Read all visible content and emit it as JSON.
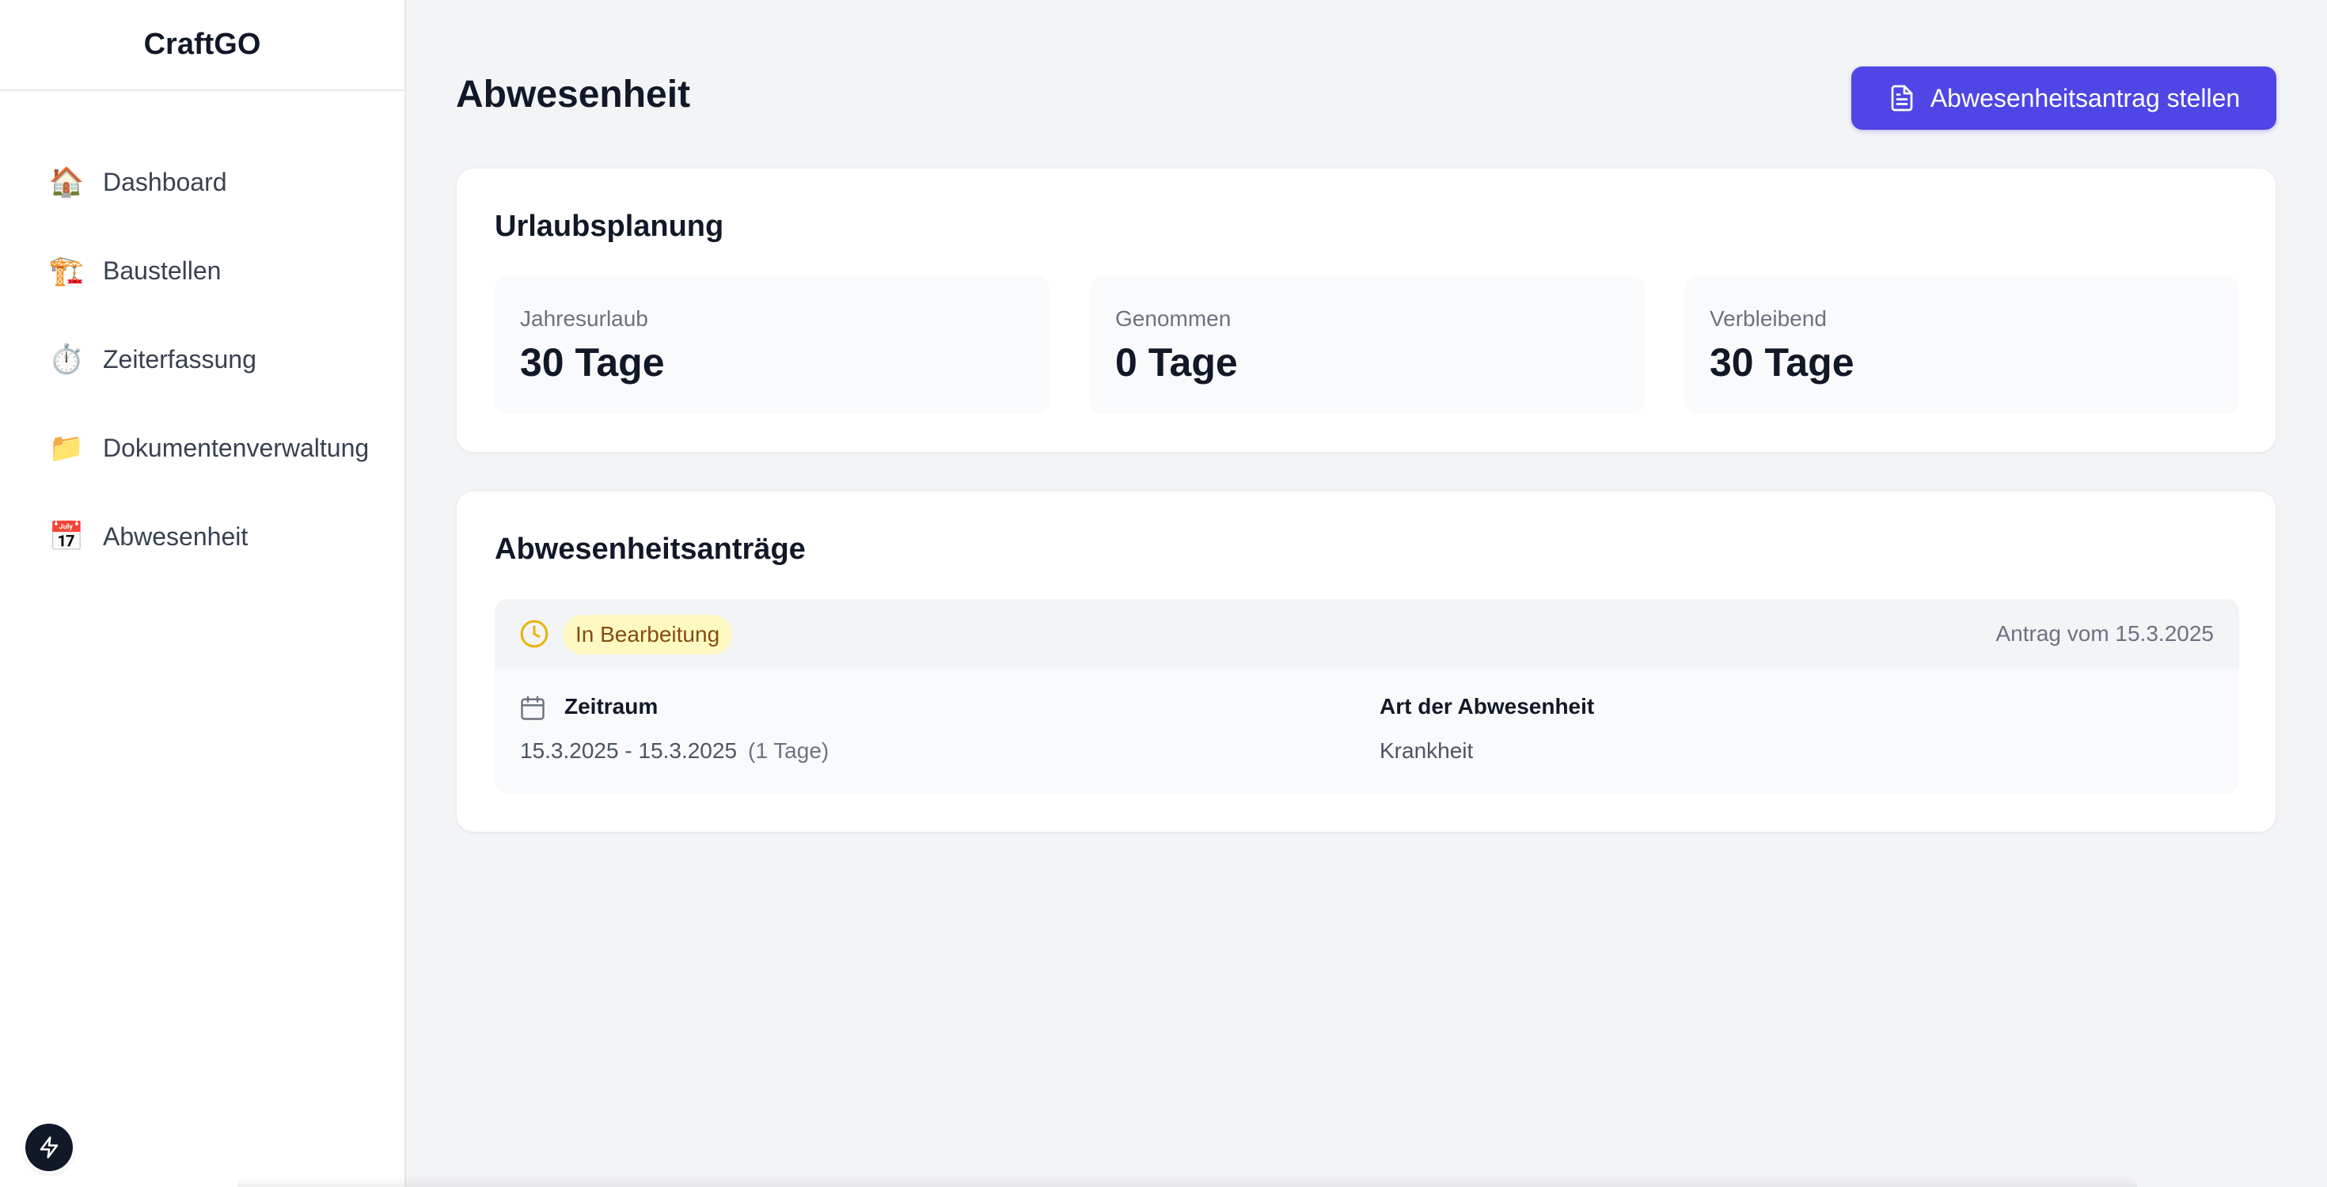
{
  "app": {
    "brand": "CraftGO"
  },
  "sidebar": {
    "items": [
      {
        "label": "Dashboard",
        "icon": "🏠"
      },
      {
        "label": "Baustellen",
        "icon": "🏗️"
      },
      {
        "label": "Zeiterfassung",
        "icon": "⏱️"
      },
      {
        "label": "Dokumentenverwaltung",
        "icon": "📁"
      },
      {
        "label": "Abwesenheit",
        "icon": "📅"
      }
    ]
  },
  "header": {
    "title": "Abwesenheit",
    "action_label": "Abwesenheitsantrag stellen"
  },
  "urlaubsplanung": {
    "title": "Urlaubsplanung",
    "stats": [
      {
        "label": "Jahresurlaub",
        "value": "30 Tage"
      },
      {
        "label": "Genommen",
        "value": "0 Tage"
      },
      {
        "label": "Verbleibend",
        "value": "30 Tage"
      }
    ]
  },
  "antraege": {
    "title": "Abwesenheitsanträge",
    "items": [
      {
        "status": "In Bearbeitung",
        "submitted": "Antrag vom 15.3.2025",
        "zeitraum_label": "Zeitraum",
        "zeitraum": "15.3.2025 - 15.3.2025",
        "tage": "(1 Tage)",
        "art_label": "Art der Abwesenheit",
        "art": "Krankheit"
      }
    ]
  },
  "colors": {
    "primary": "#4f46e5",
    "badge_bg": "#fef9c3",
    "badge_text": "#854d0e",
    "clock_icon": "#eab308"
  }
}
